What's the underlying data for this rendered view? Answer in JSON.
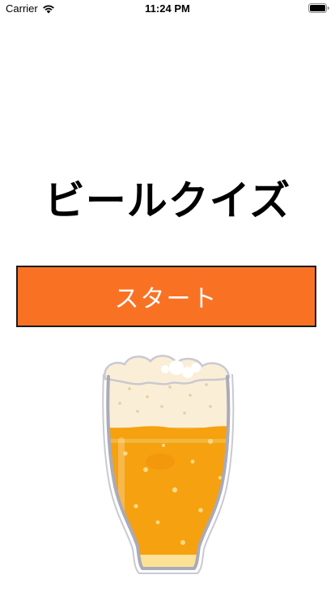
{
  "status_bar": {
    "carrier": "Carrier",
    "time": "11:24 PM",
    "wifi_icon": "wifi-icon",
    "battery_icon": "battery-icon"
  },
  "main": {
    "title": "ビールクイズ",
    "start_button_label": "スタート",
    "illustration": "beer-glass-illustration"
  },
  "colors": {
    "accent": "#f97224",
    "beer": "#f6a10f",
    "foam": "#fbeed7"
  }
}
